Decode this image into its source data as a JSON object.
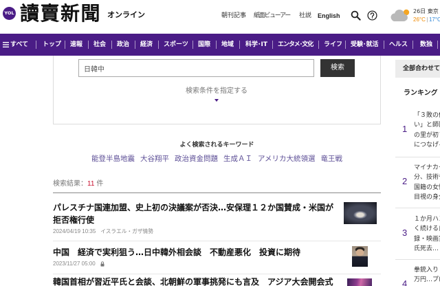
{
  "header": {
    "logo_badge": "YOL",
    "logo_title": "讀賣新聞",
    "logo_subtitle": "オンライン",
    "links": {
      "morning_edition": "朝刊記事",
      "paper_viewer": "紙面ビューアー",
      "editorial": "社説",
      "english": "English"
    },
    "weather": {
      "day_place": "26日 東京",
      "high": "26°C",
      "separator": "|",
      "low": "17°C"
    }
  },
  "nav": {
    "menu_label": "すべて",
    "items": [
      "トップ",
      "速報",
      "社会",
      "政治",
      "経済",
      "スポーツ",
      "国際",
      "地域",
      "科学･IT",
      "エンタメ･文化",
      "ライフ",
      "受験･就活",
      "ヘルス",
      "数独"
    ]
  },
  "search": {
    "query": "日韓中",
    "button_label": "検索",
    "advanced_label": "検索条件を指定する"
  },
  "popular_keywords": {
    "heading": "よく検索されるキーワード",
    "items": [
      "能登半島地震",
      "大谷翔平",
      "政治資金問題",
      "生成ＡＩ",
      "アメリカ大統領選",
      "竜王戦"
    ]
  },
  "results": {
    "count_label": "検索結果：",
    "count": "11",
    "count_unit": "件",
    "items": [
      {
        "title": "パレスチナ国連加盟、史上初の決議案が否決…安保理１２か国賛成・米国が拒否権行使",
        "date": "2024/04/19 10:35",
        "tag": "イスラエル・ガザ情勢",
        "locked": false
      },
      {
        "title": "中国　経済で実利狙う…日中韓外相会談　不動産悪化　投資に期待",
        "date": "2023/11/27 05:00",
        "locked": true
      },
      {
        "title": "韓国首相が習近平氏と会談、北朝鮮の軍事挑発にも言及　アジア大会開会式"
      }
    ]
  },
  "sidebar": {
    "all_label": "全部合わせて",
    "ranking_title": "ランキング",
    "ranking": [
      {
        "rank": "1",
        "lines": [
          "「３敗の優",
          "い」と師匠",
          "の里が初Ｖ",
          "につなげる"
        ]
      },
      {
        "rank": "2",
        "lines": [
          "マイナカー",
          "分、技術や",
          "国籍の女性",
          "目視の身分"
        ]
      },
      {
        "rank": "3",
        "lines": [
          "１か月ハン",
          "く続ける自",
          "録・映画賞",
          "氏死去…"
        ]
      },
      {
        "rank": "4",
        "lines": [
          "拳銃入り１",
          "万円…プロ"
        ]
      }
    ]
  },
  "colors": {
    "brand": "#4a1c86",
    "accent": "#c8102e",
    "keyword": "#5c4e96",
    "temp_high": "#f08a00",
    "temp_low": "#2f86d6",
    "button": "#333333"
  },
  "icons": [
    "search-icon",
    "help-icon",
    "weather-cloud-sun-icon",
    "menu-icon",
    "caret-down-icon",
    "lock-icon"
  ]
}
